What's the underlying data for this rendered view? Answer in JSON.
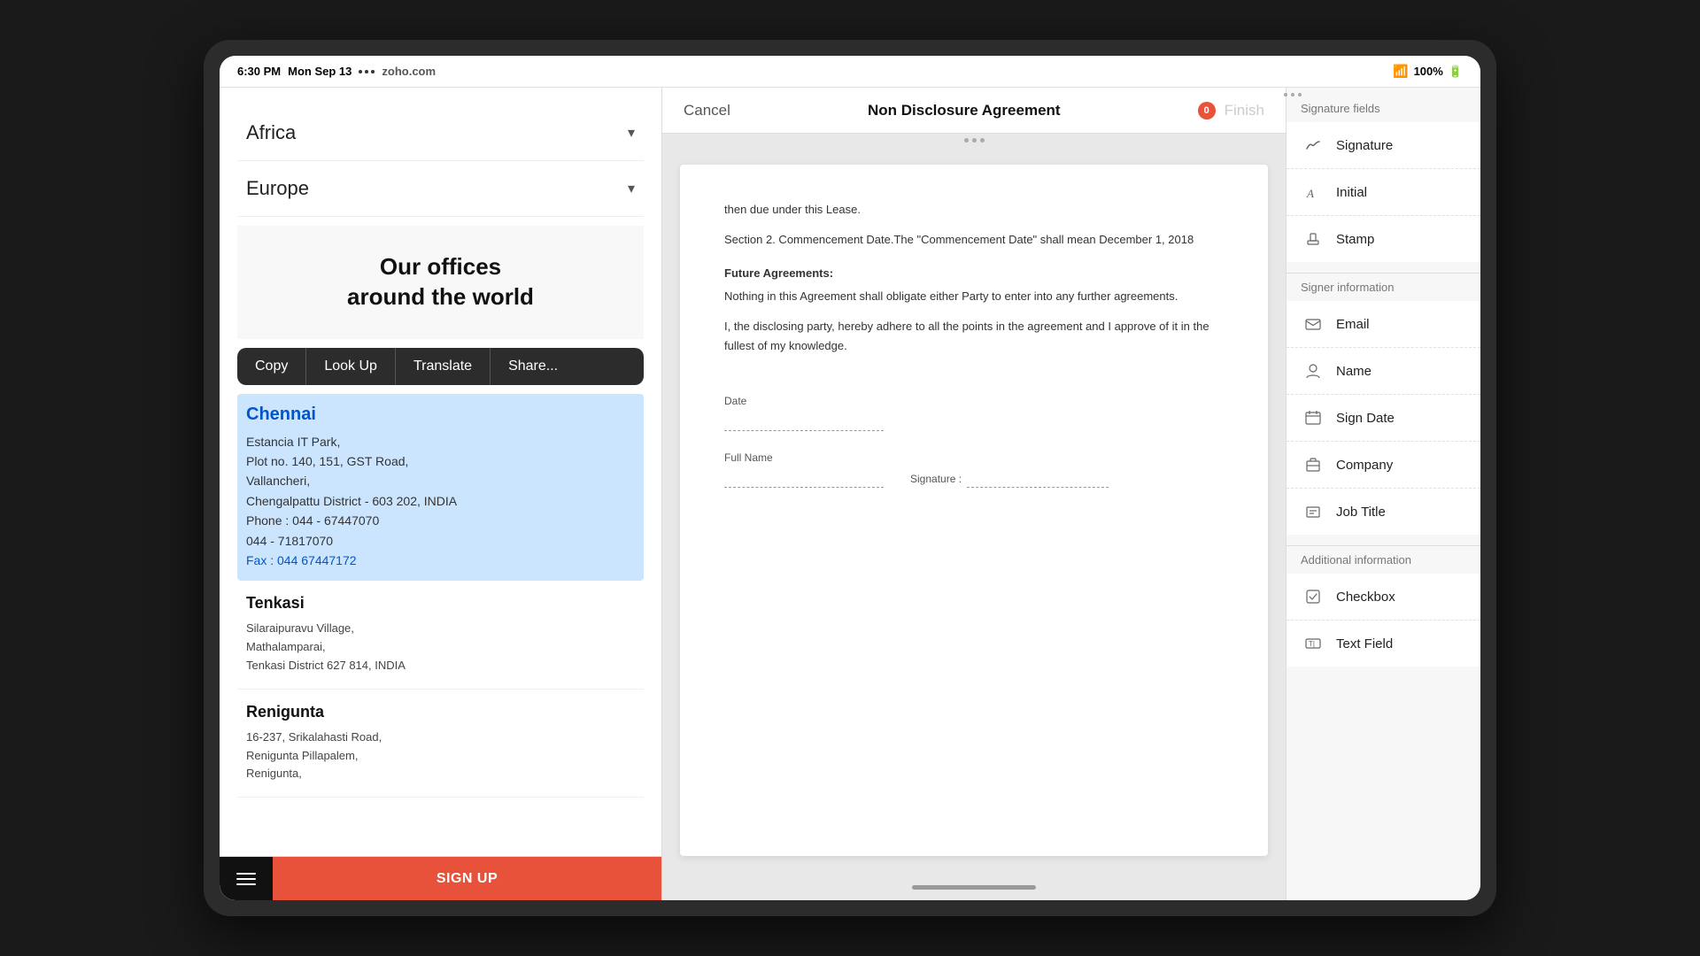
{
  "device": {
    "status_bar": {
      "time": "6:30 PM",
      "date": "Mon Sep 13",
      "network": "...",
      "website": "zoho.com",
      "wifi": "100%",
      "battery_icon": "🔋"
    }
  },
  "left_panel": {
    "accordion_items": [
      {
        "label": "Africa",
        "expanded": false
      },
      {
        "label": "Europe",
        "expanded": false
      }
    ],
    "banner_title_line1": "Our offices",
    "banner_title_line2": "around the world",
    "context_menu": {
      "buttons": [
        "Copy",
        "Look Up",
        "Translate",
        "Share..."
      ]
    },
    "selected_city": {
      "name": "Chennai",
      "address_lines": [
        "Estancia IT Park,",
        "Plot no. 140, 151, GST Road,",
        "Vallancheri,",
        "Chengalpattu District - 603 202, INDIA",
        "Phone : 044 - 67447070",
        "044 - 71817070",
        "Fax : 044 67447172"
      ]
    },
    "office_sections": [
      {
        "city": "Tenkasi",
        "address_lines": [
          "Silaraipuravu Village,",
          "Mathalamparai,",
          "Tenkasi District 627 814, INDIA"
        ]
      },
      {
        "city": "Renigunta",
        "address_lines": [
          "16-237, Srikalahasti Road,",
          "Renigunta Pillapalem,",
          "Renigunta,"
        ]
      }
    ],
    "bottom_bar": {
      "signup_label": "SIGN UP"
    }
  },
  "center_panel": {
    "top_bar": {
      "cancel_label": "Cancel",
      "title": "Non Disclosure Agreement",
      "finish_label": "Finish"
    },
    "document": {
      "text1": "then due under this Lease.",
      "text2": "Section 2.  Commencement Date.The \"Commencement Date\" shall mean  December 1, 2018",
      "section_title": "Future Agreements:",
      "text3": "Nothing in this Agreement shall obligate either Party to enter into any further agreements.",
      "text4": "I, the disclosing party, hereby adhere to all the points in the agreement and I approve of it in the fullest of my knowledge.",
      "field_date_label": "Date",
      "field_fullname_label": "Full Name",
      "field_signature_label": "Signature :"
    }
  },
  "right_panel": {
    "signature_section_title": "Signature fields",
    "signature_items": [
      {
        "icon": "✍️",
        "label": "Signature"
      },
      {
        "icon": "🖊️",
        "label": "Initial"
      },
      {
        "icon": "🔖",
        "label": "Stamp"
      }
    ],
    "signer_section_title": "Signer information",
    "signer_items": [
      {
        "icon": "✉️",
        "label": "Email"
      },
      {
        "icon": "👤",
        "label": "Name"
      },
      {
        "icon": "📅",
        "label": "Sign Date"
      },
      {
        "icon": "🏢",
        "label": "Company"
      },
      {
        "icon": "💼",
        "label": "Job Title"
      }
    ],
    "additional_section_title": "Additional information",
    "additional_items": [
      {
        "icon": "☑️",
        "label": "Checkbox"
      },
      {
        "icon": "🔤",
        "label": "Text Field"
      }
    ]
  }
}
